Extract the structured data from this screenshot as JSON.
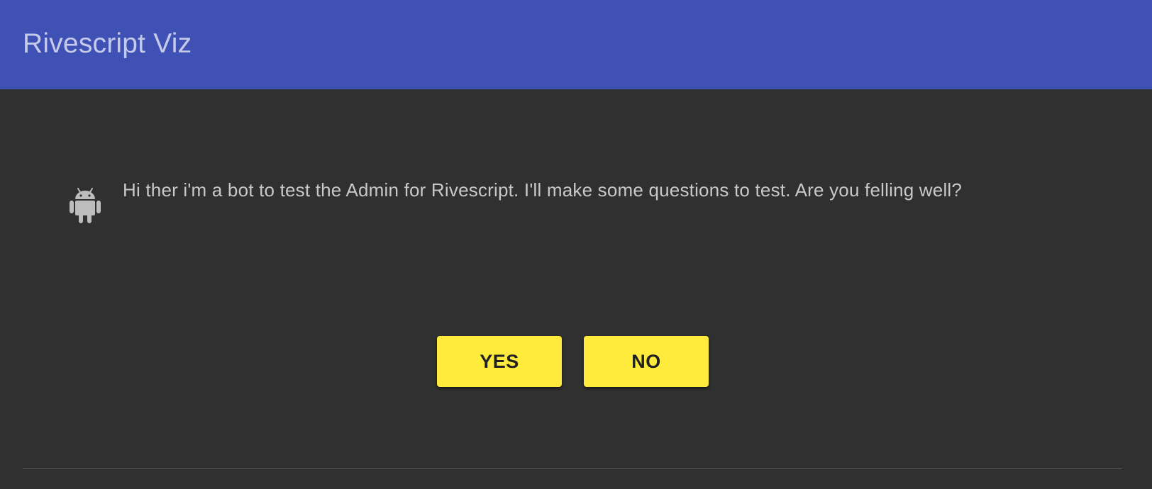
{
  "header": {
    "title": "Rivescript Viz",
    "background_color": "#3f51b5",
    "title_color": "#c5cae9"
  },
  "chat": {
    "bot_icon": "android-icon",
    "message": "Hi ther i'm a bot to test the Admin for Rivescript. I'll make some questions to test. Are you felling well?"
  },
  "actions": {
    "yes_label": "YES",
    "no_label": "NO",
    "button_color": "#ffeb3b"
  },
  "theme": {
    "background_color": "#303030",
    "text_color": "#c8c8c8"
  }
}
